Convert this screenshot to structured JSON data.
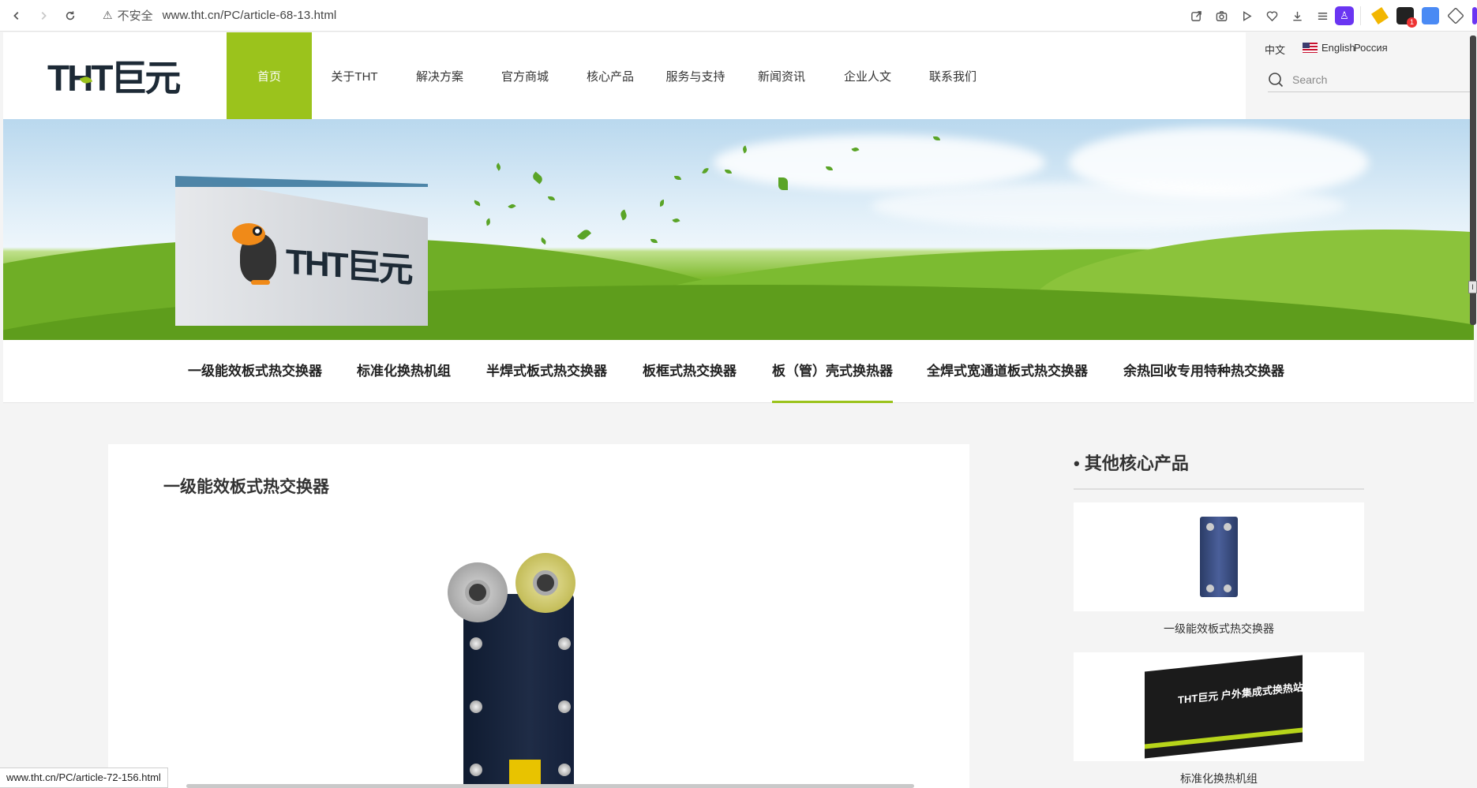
{
  "browser": {
    "security_label": "不安全",
    "url": "www.tht.cn/PC/article-68-13.html",
    "status_url": "www.tht.cn/PC/article-72-156.html",
    "extension_badge": "1"
  },
  "site": {
    "logo_text": "THT巨元",
    "nav": [
      {
        "label": "首页",
        "active": true
      },
      {
        "label": "关于THT",
        "active": false
      },
      {
        "label": "解决方案",
        "active": false
      },
      {
        "label": "官方商城",
        "active": false
      },
      {
        "label": "核心产品",
        "active": false
      },
      {
        "label": "服务与支持",
        "active": false
      },
      {
        "label": "新闻资讯",
        "active": false
      },
      {
        "label": "企业人文",
        "active": false
      },
      {
        "label": "联系我们",
        "active": false
      }
    ],
    "languages": {
      "zh": "中文",
      "en": "English",
      "ru": "Россия"
    },
    "search": {
      "placeholder": "Search"
    }
  },
  "banner": {
    "sign_text": "THT巨元"
  },
  "subnav": [
    {
      "label": "一级能效板式热交换器",
      "active": false
    },
    {
      "label": "标准化换热机组",
      "active": false
    },
    {
      "label": "半焊式板式热交换器",
      "active": false
    },
    {
      "label": "板框式热交换器",
      "active": false
    },
    {
      "label": "板（管）壳式换热器",
      "active": true
    },
    {
      "label": "全焊式宽通道板式热交换器",
      "active": false
    },
    {
      "label": "余热回收专用特种热交换器",
      "active": false
    }
  ],
  "article": {
    "title": "一级能效板式热交换器"
  },
  "sidebar": {
    "title": "• 其他核心产品",
    "products": [
      {
        "caption": "一级能效板式热交换器"
      },
      {
        "caption": "标准化换热机组",
        "container_text": "THT巨元  户外集成式换热站"
      }
    ]
  },
  "colors": {
    "accent": "#9bc31c",
    "logo": "#1d2a36"
  }
}
